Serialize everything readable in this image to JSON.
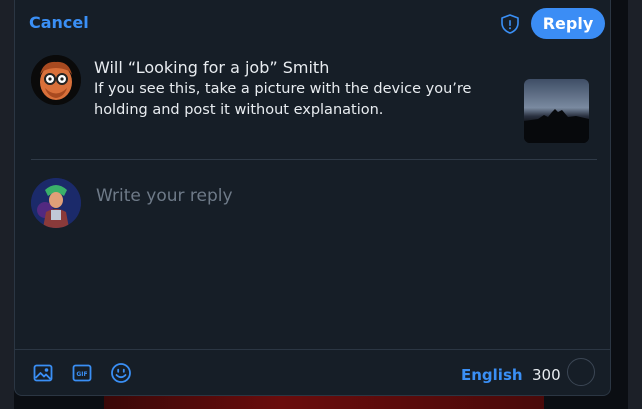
{
  "header": {
    "cancel_label": "Cancel",
    "reply_label": "Reply"
  },
  "post": {
    "author": "Will “Looking for a job” Smith",
    "text": "If you see this, take a picture with the device you’re holding and post it without explanation."
  },
  "composer": {
    "placeholder": "Write your reply"
  },
  "toolbar": {
    "language": "English",
    "char_count": "300"
  },
  "icons": [
    "shield-icon",
    "image-icon",
    "gif-icon",
    "emoji-icon"
  ],
  "colors": {
    "accent": "#3b8df5",
    "background": "#161e27",
    "text": "#e8ecf0"
  }
}
